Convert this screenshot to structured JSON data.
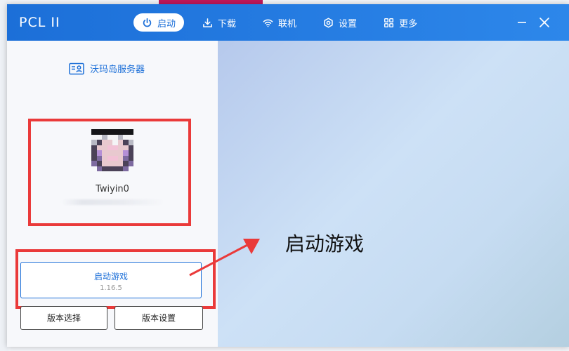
{
  "app": {
    "title": "PCL II"
  },
  "nav": {
    "items": [
      {
        "label": "启动",
        "icon": "power-icon",
        "active": true
      },
      {
        "label": "下载",
        "icon": "download-icon",
        "active": false
      },
      {
        "label": "联机",
        "icon": "wifi-icon",
        "active": false
      },
      {
        "label": "设置",
        "icon": "settings-icon",
        "active": false
      },
      {
        "label": "更多",
        "icon": "grid-icon",
        "active": false
      }
    ]
  },
  "window_controls": {
    "minimize_icon": "minimize-icon",
    "close_icon": "close-icon"
  },
  "sidebar": {
    "server_name": "沃玛岛服务器",
    "server_icon": "server-card-icon",
    "username": "Twiyin0",
    "launch_button": {
      "label": "启动游戏",
      "version": "1.16.5"
    },
    "version_select_label": "版本选择",
    "version_settings_label": "版本设置"
  },
  "annotation": {
    "text": "启动游戏"
  },
  "colors": {
    "accent": "#1c6fd8",
    "highlight_box": "#ea3a3a"
  }
}
